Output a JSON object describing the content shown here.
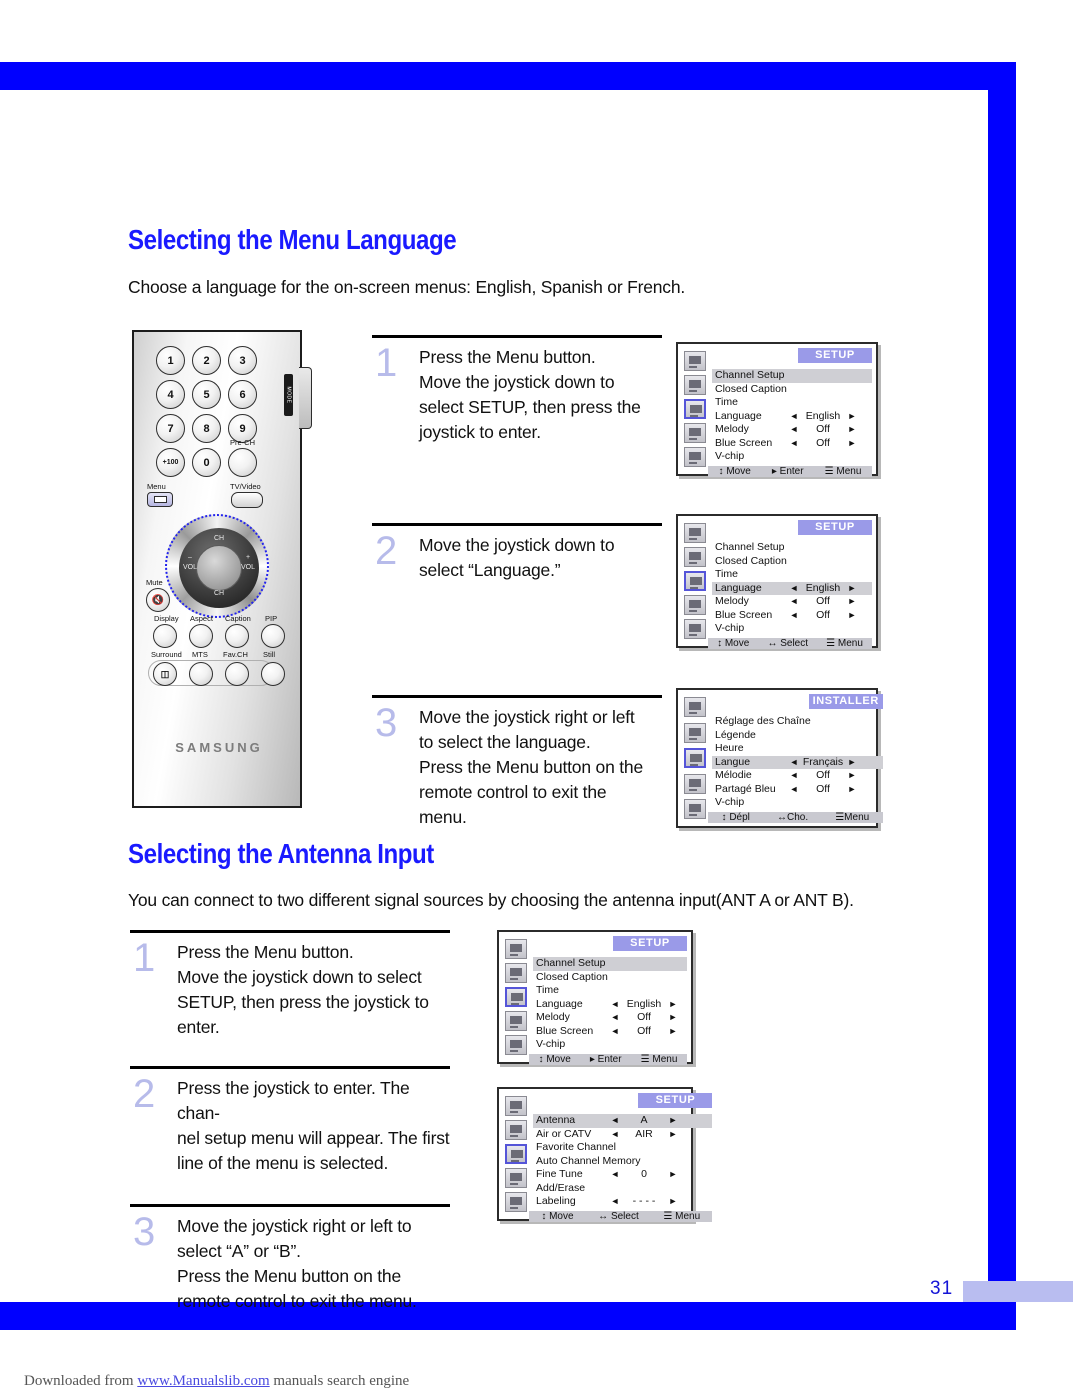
{
  "page": {
    "number": "31",
    "footer_prefix": "Downloaded from ",
    "footer_link": "www.Manualslib.com",
    "footer_suffix": " manuals search engine",
    "accent_blue": "#0000ff",
    "step_number_color": "#b7bbea"
  },
  "section1": {
    "heading": "Selecting the Menu Language",
    "intro": "Choose a language for the on-screen menus: English, Spanish or French.",
    "steps": [
      {
        "num": "1",
        "lines": [
          "Press the Menu button.",
          "Move the joystick down to",
          "select SETUP, then press the",
          "joystick to enter."
        ]
      },
      {
        "num": "2",
        "lines": [
          "Move the joystick down to",
          "select “Language.”"
        ]
      },
      {
        "num": "3",
        "lines": [
          "Move the joystick right or left",
          "to select the language.",
          "Press the Menu button on the",
          "remote control to exit the",
          "menu."
        ]
      }
    ]
  },
  "section2": {
    "heading": "Selecting the Antenna Input",
    "intro": "You can connect to two different signal sources by choosing the antenna input(ANT A or ANT B).",
    "steps": [
      {
        "num": "1",
        "lines": [
          "Press the Menu button.",
          "Move the joystick down to select",
          "SETUP, then press the joystick to",
          "enter."
        ]
      },
      {
        "num": "2",
        "lines": [
          "Press the joystick to enter. The chan-",
          "nel setup menu will appear. The first",
          "line of the menu is selected."
        ]
      },
      {
        "num": "3",
        "lines": [
          "Move the joystick right or left to",
          "select “A” or “B”.",
          "Press the Menu button on the",
          "remote control to exit the menu."
        ]
      }
    ]
  },
  "osd": [
    {
      "id": "setup-channel-highlight",
      "title": "SETUP",
      "selected_icon_index": 2,
      "rows": [
        {
          "label": "Channel Setup",
          "left_arrow": "",
          "value": "",
          "right_arrow": "",
          "highlight": true
        },
        {
          "label": "Closed Caption",
          "left_arrow": "",
          "value": "",
          "right_arrow": "",
          "highlight": false
        },
        {
          "label": "Time",
          "left_arrow": "",
          "value": "",
          "right_arrow": "",
          "highlight": false
        },
        {
          "label": "Language",
          "left_arrow": "◄",
          "value": "English",
          "right_arrow": "►",
          "highlight": false
        },
        {
          "label": "Melody",
          "left_arrow": "◄",
          "value": "Off",
          "right_arrow": "►",
          "highlight": false
        },
        {
          "label": "Blue Screen",
          "left_arrow": "◄",
          "value": "Off",
          "right_arrow": "►",
          "highlight": false
        },
        {
          "label": "V-chip",
          "left_arrow": "",
          "value": "",
          "right_arrow": "",
          "highlight": false
        }
      ],
      "footer": [
        "↕ Move",
        "▸ Enter",
        "☰ Menu"
      ]
    },
    {
      "id": "setup-language-highlight",
      "title": "SETUP",
      "selected_icon_index": 2,
      "rows": [
        {
          "label": "Channel Setup",
          "left_arrow": "",
          "value": "",
          "right_arrow": "",
          "highlight": false
        },
        {
          "label": "Closed Caption",
          "left_arrow": "",
          "value": "",
          "right_arrow": "",
          "highlight": false
        },
        {
          "label": "Time",
          "left_arrow": "",
          "value": "",
          "right_arrow": "",
          "highlight": false
        },
        {
          "label": "Language",
          "left_arrow": "◄",
          "value": "English",
          "right_arrow": "►",
          "highlight": true
        },
        {
          "label": "Melody",
          "left_arrow": "◄",
          "value": "Off",
          "right_arrow": "►",
          "highlight": false
        },
        {
          "label": "Blue Screen",
          "left_arrow": "◄",
          "value": "Off",
          "right_arrow": "►",
          "highlight": false
        },
        {
          "label": "V-chip",
          "left_arrow": "",
          "value": "",
          "right_arrow": "",
          "highlight": false
        }
      ],
      "footer": [
        "↕ Move",
        "↔ Select",
        "☰ Menu"
      ]
    },
    {
      "id": "installer-french",
      "title": "INSTALLER",
      "selected_icon_index": 2,
      "rows": [
        {
          "label": "Réglage des Chaîne",
          "left_arrow": "",
          "value": "",
          "right_arrow": "",
          "highlight": false
        },
        {
          "label": "Légende",
          "left_arrow": "",
          "value": "",
          "right_arrow": "",
          "highlight": false
        },
        {
          "label": "Heure",
          "left_arrow": "",
          "value": "",
          "right_arrow": "",
          "highlight": false
        },
        {
          "label": "Langue",
          "left_arrow": "◄",
          "value": "Français",
          "right_arrow": "►",
          "highlight": true
        },
        {
          "label": "Mélodie",
          "left_arrow": "◄",
          "value": "Off",
          "right_arrow": "►",
          "highlight": false
        },
        {
          "label": "Partagé Bleu",
          "left_arrow": "◄",
          "value": "Off",
          "right_arrow": "►",
          "highlight": false
        },
        {
          "label": "V-chip",
          "left_arrow": "",
          "value": "",
          "right_arrow": "",
          "highlight": false
        }
      ],
      "footer": [
        "↕ Dépl",
        "↔Cho.",
        "☰Menu"
      ]
    },
    {
      "id": "setup-channel-highlight-2",
      "title": "SETUP",
      "selected_icon_index": 2,
      "rows": [
        {
          "label": "Channel Setup",
          "left_arrow": "",
          "value": "",
          "right_arrow": "",
          "highlight": true
        },
        {
          "label": "Closed Caption",
          "left_arrow": "",
          "value": "",
          "right_arrow": "",
          "highlight": false
        },
        {
          "label": "Time",
          "left_arrow": "",
          "value": "",
          "right_arrow": "",
          "highlight": false
        },
        {
          "label": "Language",
          "left_arrow": "◄",
          "value": "English",
          "right_arrow": "►",
          "highlight": false
        },
        {
          "label": "Melody",
          "left_arrow": "◄",
          "value": "Off",
          "right_arrow": "►",
          "highlight": false
        },
        {
          "label": "Blue Screen",
          "left_arrow": "◄",
          "value": "Off",
          "right_arrow": "►",
          "highlight": false
        },
        {
          "label": "V-chip",
          "left_arrow": "",
          "value": "",
          "right_arrow": "",
          "highlight": false
        }
      ],
      "footer": [
        "↕ Move",
        "▸ Enter",
        "☰ Menu"
      ]
    },
    {
      "id": "setup-antenna",
      "title": "SETUP",
      "selected_icon_index": 2,
      "rows": [
        {
          "label": "Antenna",
          "left_arrow": "◄",
          "value": "A",
          "right_arrow": "►",
          "highlight": true
        },
        {
          "label": "Air or CATV",
          "left_arrow": "◄",
          "value": "AIR",
          "right_arrow": "►",
          "highlight": false
        },
        {
          "label": "Favorite Channel",
          "left_arrow": "",
          "value": "",
          "right_arrow": "",
          "highlight": false
        },
        {
          "label": "Auto Channel Memory",
          "left_arrow": "",
          "value": "",
          "right_arrow": "",
          "highlight": false
        },
        {
          "label": "Fine Tune",
          "left_arrow": "◄",
          "value": "0",
          "right_arrow": "►",
          "highlight": false
        },
        {
          "label": "Add/Erase",
          "left_arrow": "",
          "value": "",
          "right_arrow": "",
          "highlight": false
        },
        {
          "label": "Labeling",
          "left_arrow": "◄",
          "value": "- - - -",
          "right_arrow": "►",
          "highlight": false
        }
      ],
      "footer": [
        "↕ Move",
        "↔ Select",
        "☰ Menu"
      ]
    }
  ],
  "remote": {
    "brand": "SAMSUNG",
    "mode_label": "MODE",
    "keypad": [
      "1",
      "2",
      "3",
      "4",
      "5",
      "6",
      "7",
      "8",
      "9",
      "+100",
      "0",
      ""
    ],
    "pre_ch_label": "Pre-CH",
    "menu_label": "Menu",
    "tv_video_label": "TV/Video",
    "mute_label": "Mute",
    "joystick": {
      "up": "CH",
      "down": "CH",
      "left": "VOL",
      "right": "VOL",
      "left_sign": "–",
      "right_sign": "+"
    },
    "row_labels_1": [
      "Display",
      "Aspect",
      "Caption",
      "PIP"
    ],
    "row_labels_2": [
      "Surround",
      "MTS",
      "Fav.CH",
      "Still"
    ]
  }
}
